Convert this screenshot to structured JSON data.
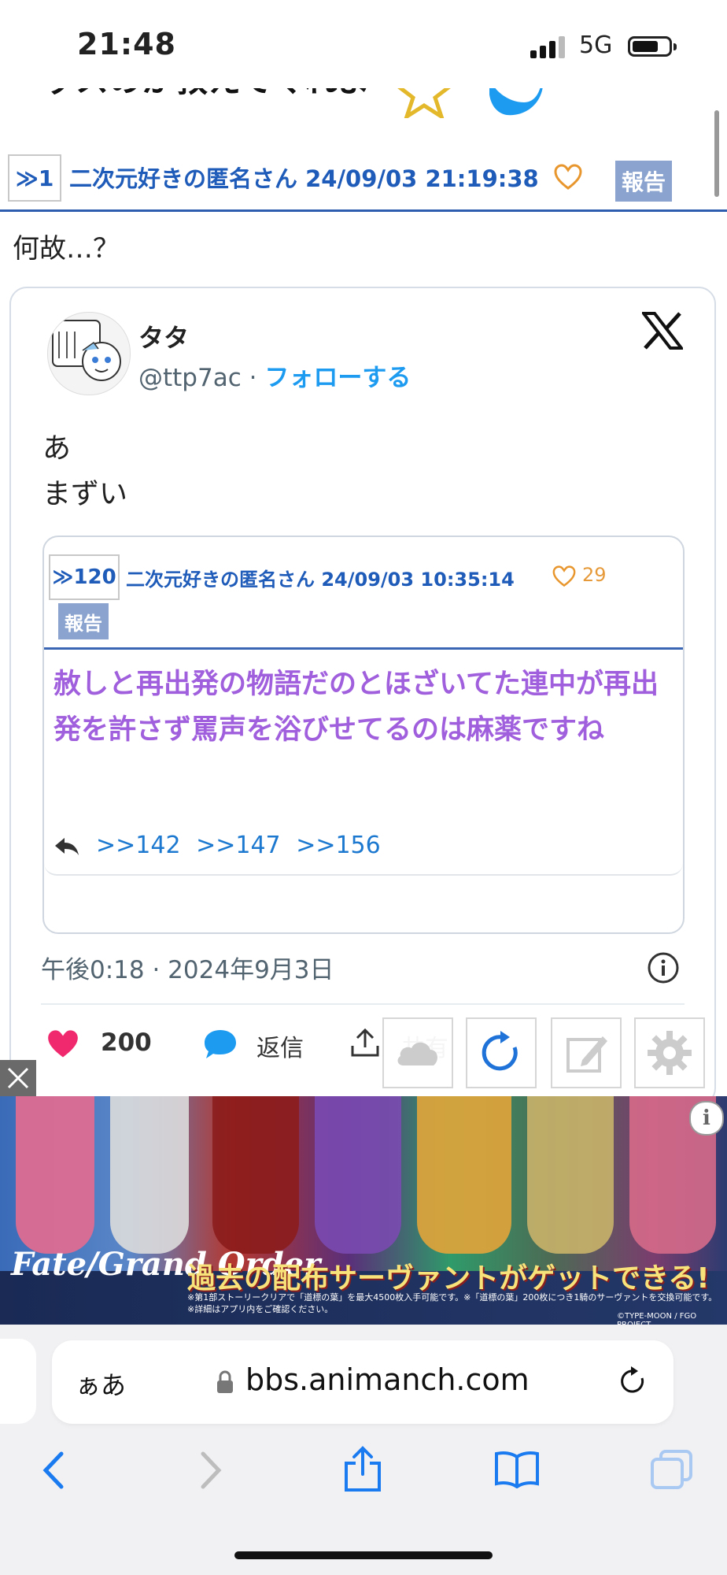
{
  "status": {
    "time": "21:48",
    "network": "5G"
  },
  "page": {
    "partial_line": "ッスのか教えてくれよ",
    "post": {
      "res_link": "≫1",
      "poster_line": "二次元好きの匿名さん 24/09/03 21:19:38",
      "report_label": "報告",
      "body": "何故…？"
    },
    "tweet": {
      "author": "タタ",
      "handle": "@ttp7ac",
      "separator": " · ",
      "follow_label": "フォローする",
      "line1": "あ",
      "line2": "まずい",
      "embed": {
        "res_link": "≫120",
        "poster_line": "二次元好きの匿名さん 24/09/03 10:35:14",
        "like_count": "29",
        "report_label": "報告",
        "body": "赦しと再出発の物語だのとほざいてた連中が再出発を許さず罵声を浴びせてるのは麻薬ですね",
        "replies": [
          ">>142",
          ">>147",
          ">>156"
        ]
      },
      "date": "午後0:18 · 2024年9月3日",
      "likes": "200",
      "reply_label": "返信",
      "share_label": "共有"
    }
  },
  "ad": {
    "logo_line1": "Fate/Grand Order",
    "slogan": "過去の配布サーヴァントがゲットできる!",
    "fine_print_1": "※第1部ストーリークリアで「道標の葉」を最大4500枚入手可能です。※「道標の葉」200枚につき1騎のサーヴァントを交換可能です。",
    "fine_print_2": "※詳細はアプリ内をご確認ください。",
    "copyright": "©TYPE-MOON / FGO PROJECT"
  },
  "browser": {
    "aa_label": "ぁあ",
    "url": "bbs.animanch.com"
  },
  "colors": {
    "link_blue": "#1f5bb8",
    "embed_text_purple": "#a05fdc",
    "heart_pink": "#f0286e",
    "report_bg": "#8aa3cf"
  }
}
